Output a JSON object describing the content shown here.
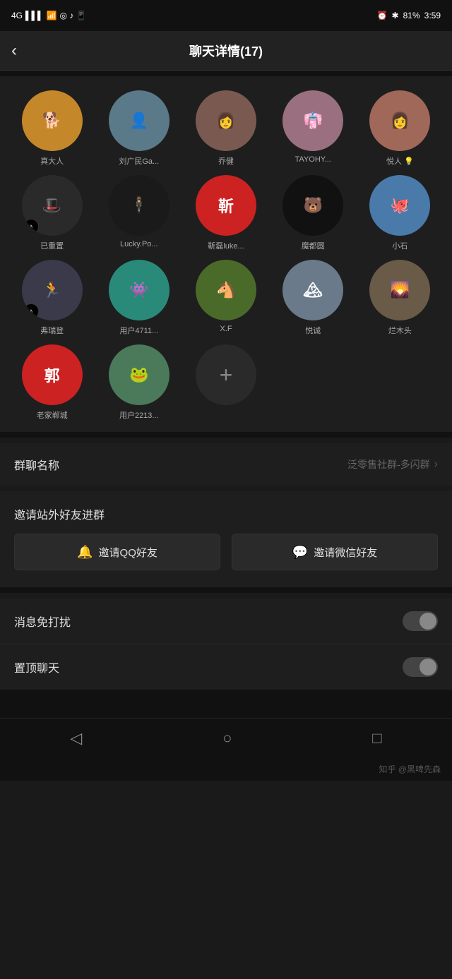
{
  "statusBar": {
    "signal": "4G",
    "wifi": "wifi",
    "time": "3:59",
    "battery": "81%"
  },
  "header": {
    "back": "‹",
    "title": "聊天详情(17)"
  },
  "members": [
    {
      "name": "真大人",
      "bg": "#c4882a",
      "text": "🐕",
      "tiktok": false
    },
    {
      "name": "刘广民Ga...",
      "bg": "#5a7a8a",
      "text": "👤",
      "tiktok": false
    },
    {
      "name": "乔健",
      "bg": "#7a5a50",
      "text": "👩",
      "tiktok": false
    },
    {
      "name": "TAYOHY...",
      "bg": "#9a7080",
      "text": "👘",
      "tiktok": false
    },
    {
      "name": "悦人 💡",
      "bg": "#a06858",
      "text": "👩",
      "tiktok": false
    },
    {
      "name": "已重置",
      "bg": "#2a2a2a",
      "text": "🎩",
      "tiktok": true
    },
    {
      "name": "Lucky.Po...",
      "bg": "#1a1a1a",
      "text": "🕴",
      "tiktok": false
    },
    {
      "name": "靳磊luke...",
      "bg": "#cc2222",
      "text": "靳",
      "tiktok": false
    },
    {
      "name": "魔都圆",
      "bg": "#111",
      "text": "🐻",
      "tiktok": false
    },
    {
      "name": "小石",
      "bg": "#4a7aaa",
      "text": "🐙",
      "tiktok": false
    },
    {
      "name": "弗瑞登",
      "bg": "#3a3a4a",
      "text": "🏃",
      "tiktok": true
    },
    {
      "name": "用户4711...",
      "bg": "#2a8a7a",
      "text": "👾",
      "tiktok": false
    },
    {
      "name": "X.F",
      "bg": "#4a6a2a",
      "text": "🐴",
      "tiktok": false
    },
    {
      "name": "悦诚",
      "bg": "#6a7a8a",
      "text": "🏔",
      "tiktok": false
    },
    {
      "name": "烂木头",
      "bg": "#6a5a48",
      "text": "🌄",
      "tiktok": false
    },
    {
      "name": "老家郸城",
      "bg": "#cc2222",
      "text": "郭",
      "tiktok": false
    },
    {
      "name": "用户2213...",
      "bg": "#4a7a5a",
      "text": "🐸",
      "tiktok": false
    }
  ],
  "groupName": {
    "label": "群聊名称",
    "value": "泛零售社群-多闪群",
    "chevron": "›"
  },
  "invite": {
    "title": "邀请站外好友进群",
    "qqBtn": "邀请QQ好友",
    "wechatBtn": "邀请微信好友",
    "qqIcon": "🔔",
    "wechatIcon": "💬"
  },
  "settings": [
    {
      "label": "消息免打扰",
      "type": "toggle"
    },
    {
      "label": "置顶聊天",
      "type": "toggle"
    }
  ],
  "bottomNav": {
    "back": "◁",
    "home": "○",
    "recent": "□"
  },
  "watermark": "知乎 @黑啤先森"
}
